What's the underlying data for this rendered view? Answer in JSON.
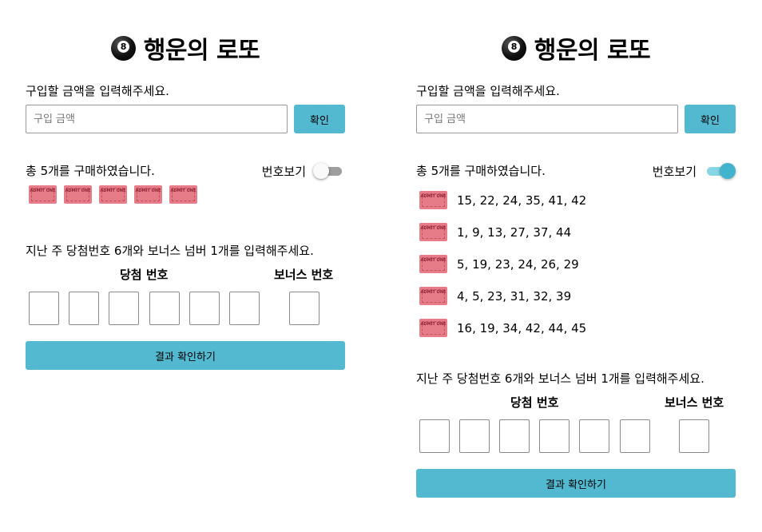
{
  "left": {
    "title": "행운의 로또",
    "ball_number": "8",
    "purchase_label": "구입할 금액을 입력해주세요.",
    "purchase_placeholder": "구입 금액",
    "confirm_label": "확인",
    "count_text": "총 5개를 구매하였습니다.",
    "toggle_label": "번호보기",
    "toggle_on": false,
    "ticket_text": "ADMIT ONE",
    "ticket_count": 5,
    "winning_instruction": "지난 주 당첨번호 6개와 보너스 넘버 1개를 입력해주세요.",
    "winning_header": "당첨 번호",
    "bonus_header": "보너스 번호",
    "result_button": "결과 확인하기"
  },
  "right": {
    "title": "행운의 로또",
    "ball_number": "8",
    "purchase_label": "구입할 금액을 입력해주세요.",
    "purchase_placeholder": "구입 금액",
    "confirm_label": "확인",
    "count_text": "총 5개를 구매하였습니다.",
    "toggle_label": "번호보기",
    "toggle_on": true,
    "ticket_text": "ADMIT ONE",
    "tickets": [
      {
        "numbers": "15, 22, 24, 35, 41, 42"
      },
      {
        "numbers": "1, 9, 13, 27, 37, 44"
      },
      {
        "numbers": "5, 19, 23, 24, 26, 29"
      },
      {
        "numbers": "4, 5, 23, 31, 32, 39"
      },
      {
        "numbers": "16, 19, 34, 42, 44, 45"
      }
    ],
    "winning_instruction": "지난 주 당첨번호 6개와 보너스 넘버 1개를 입력해주세요.",
    "winning_header": "당첨 번호",
    "bonus_header": "보너스 번호",
    "result_button": "결과 확인하기"
  }
}
